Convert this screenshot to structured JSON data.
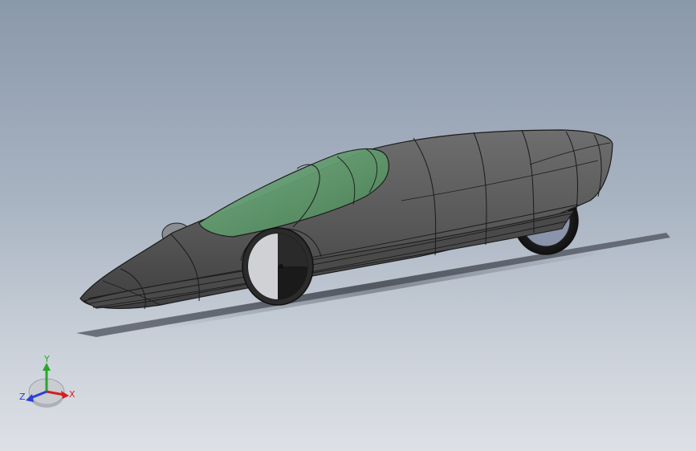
{
  "view_triad": {
    "x_label": "X",
    "y_label": "Y",
    "z_label": "Z",
    "x_color": "#d21f1f",
    "y_color": "#2aa52a",
    "z_color": "#2a3fd6"
  },
  "colors": {
    "body": "#5c5c5c",
    "canopy": "#5f9a6a",
    "edge": "#1a1a1a"
  }
}
